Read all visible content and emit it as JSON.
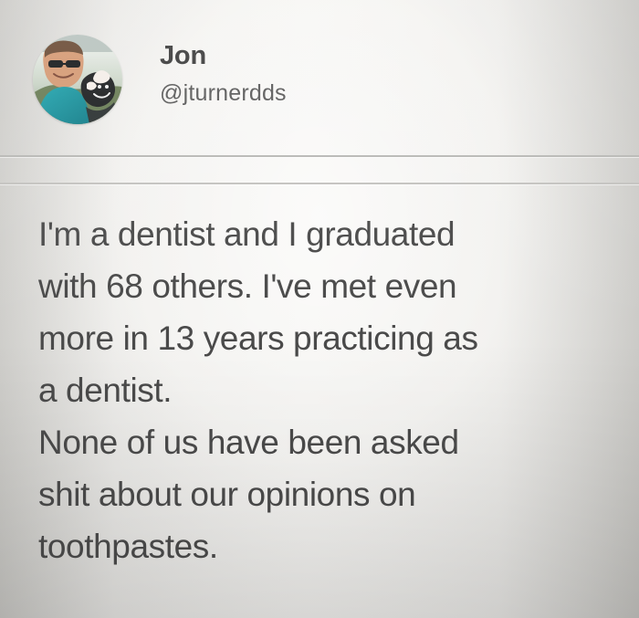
{
  "profile": {
    "avatar_icon": "profile-photo-icon",
    "display_name": "Jon",
    "username": "@jturnerdds"
  },
  "post": {
    "lines": [
      "I'm a dentist and I graduated",
      "with 68 others. I've met even",
      "more in 13 years practicing as",
      "a dentist.",
      "None of us have been asked",
      "shit about our opinions on",
      "toothpastes."
    ]
  },
  "colors": {
    "page_background": "#f0efec",
    "text": "#4a4a4a",
    "divider": "#b8b8b5"
  }
}
